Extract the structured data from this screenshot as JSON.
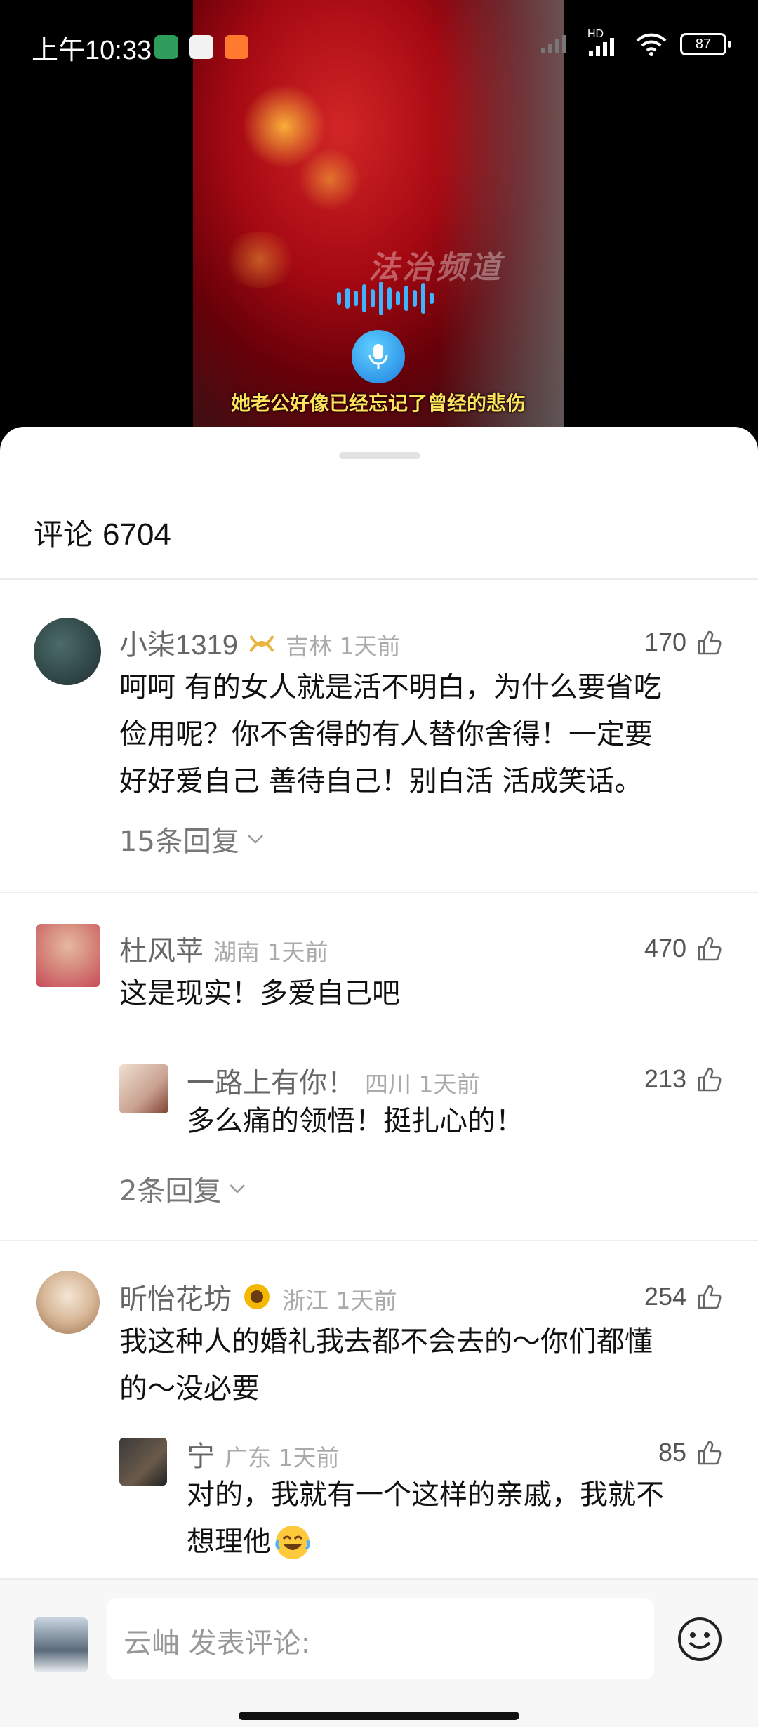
{
  "status_bar": {
    "time": "上午10:33",
    "network_label": "HD",
    "battery": "87"
  },
  "video": {
    "watermark": "法治频道",
    "subtitle": "她老公好像已经忘记了曾经的悲伤"
  },
  "comments_header": {
    "title": "评论",
    "count": "6704"
  },
  "comments": [
    {
      "username": "小柒",
      "username_num": "1319",
      "location": "吉林 1天前",
      "likes": "170",
      "text_lines": [
        "呵呵 有的女人就是活不明白，为什么要省吃",
        "俭用呢？你不舍得的有人替你舍得！一定要",
        "好好爱自己 善待自己！别白活 活成笑话。"
      ],
      "replies_label": "15条回复"
    },
    {
      "username": "杜风苹",
      "location": "湖南 1天前",
      "likes": "470",
      "text": "这是现实！多爱自己吧",
      "reply": {
        "username": "一路上有你！",
        "location": "四川 1天前",
        "likes": "213",
        "text": "多么痛的领悟！挺扎心的！"
      },
      "replies_label": "2条回复"
    },
    {
      "username": "昕怡花坊",
      "location": "浙江 1天前",
      "likes": "254",
      "text_lines": [
        "我这种人的婚礼我去都不会去的～你们都懂",
        "的～没必要"
      ],
      "reply": {
        "username": "宁",
        "location": "广东 1天前",
        "likes": "85",
        "text_lines": [
          "对的，我就有一个这样的亲戚，我就不",
          "想理他"
        ]
      }
    }
  ],
  "input": {
    "placeholder": "云岫 发表评论:"
  },
  "colors": {
    "subtitle": "#ffe15a",
    "accent_blue": "#1e7fe0"
  }
}
